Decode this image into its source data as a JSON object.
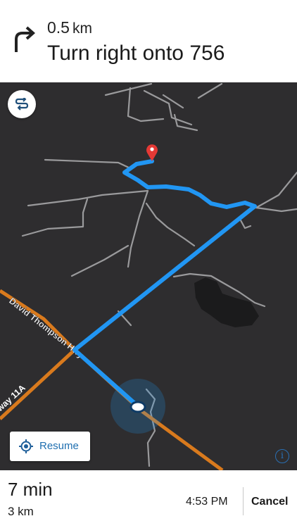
{
  "banner": {
    "distance_value": "0.5",
    "distance_unit": "km",
    "instruction": "Turn right onto 756",
    "maneuver_icon": "turn-right-arrow-icon"
  },
  "map": {
    "road_labels": [
      "David Thompson Hwy",
      "way 11A"
    ],
    "route_color": "#2196f3",
    "highway_color": "#d97a1d",
    "destination_marker_color": "#e53935",
    "controls": {
      "route_options_icon": "route-options-icon",
      "resume_label": "Resume",
      "resume_icon": "recenter-icon",
      "info_icon": "info-icon",
      "info_glyph": "i"
    }
  },
  "footer": {
    "remaining_time": "7 min",
    "remaining_distance": "3 km",
    "arrival_time": "4:53 PM",
    "cancel_label": "Cancel"
  }
}
